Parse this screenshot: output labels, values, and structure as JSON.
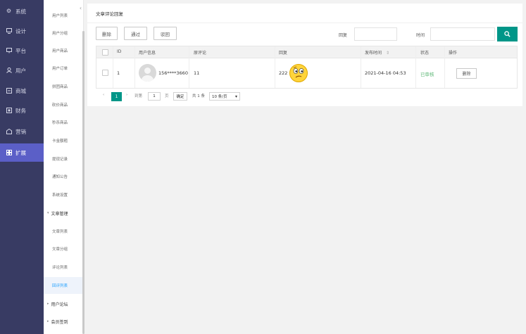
{
  "nav": {
    "items": [
      {
        "label": "系统",
        "icon": "gear-icon"
      },
      {
        "label": "设计",
        "icon": "design-icon"
      },
      {
        "label": "平台",
        "icon": "monitor-icon"
      },
      {
        "label": "用户",
        "icon": "user-icon"
      },
      {
        "label": "商城",
        "icon": "shop-icon"
      },
      {
        "label": "财务",
        "icon": "finance-icon"
      },
      {
        "label": "营销",
        "icon": "marketing-icon"
      },
      {
        "label": "扩展",
        "icon": "extension-icon"
      }
    ],
    "active": "扩展"
  },
  "submenu": {
    "items": [
      "用户列表",
      "用户分组",
      "用户商品",
      "用户订单",
      "拼团商品",
      "砍价商品",
      "秒杀商品",
      "卡金额粗",
      "提现记录",
      "通知公告",
      "系统设置"
    ],
    "group_article": "文章管理",
    "article_items": [
      "文章列表",
      "文章分组",
      "评论列表",
      "回评列表"
    ],
    "group_forum": "用户论坛",
    "group_signin": "会员签到",
    "active": "回评列表",
    "collapse_icon": "chevron-left-icon"
  },
  "page": {
    "title": "文章评论回复",
    "buttons": {
      "delete": "删除",
      "approve": "通过",
      "reject": "驳回"
    },
    "filters": {
      "reply_label": "回复",
      "time_label": "时间",
      "reply_value": "",
      "time_value": "",
      "search_icon": "search-icon"
    }
  },
  "table": {
    "headers": [
      "ID",
      "用户信息",
      "原评论",
      "回复",
      "发布时间",
      "状态",
      "操作"
    ],
    "sort_icon": "sort-icon",
    "rows": [
      {
        "id": "1",
        "user": "156****3660",
        "original_comment": "11",
        "reply": "222",
        "reply_emoji": "thinking-face-emoji",
        "time": "2021-04-16 04:53",
        "status": "已审核",
        "action": "删除"
      }
    ]
  },
  "pagination": {
    "prev": "‹",
    "current": "1",
    "next": "›",
    "goto_label": "到第",
    "page_input": "1",
    "page_unit": "页",
    "confirm": "确定",
    "total": "共 1 条",
    "page_size": "10 条/页"
  },
  "colors": {
    "nav_bg": "#383b63",
    "nav_active": "#5b5fc7",
    "accent_green": "#009688",
    "status_green": "#5fb878",
    "submenu_active": "#1e9fff"
  }
}
